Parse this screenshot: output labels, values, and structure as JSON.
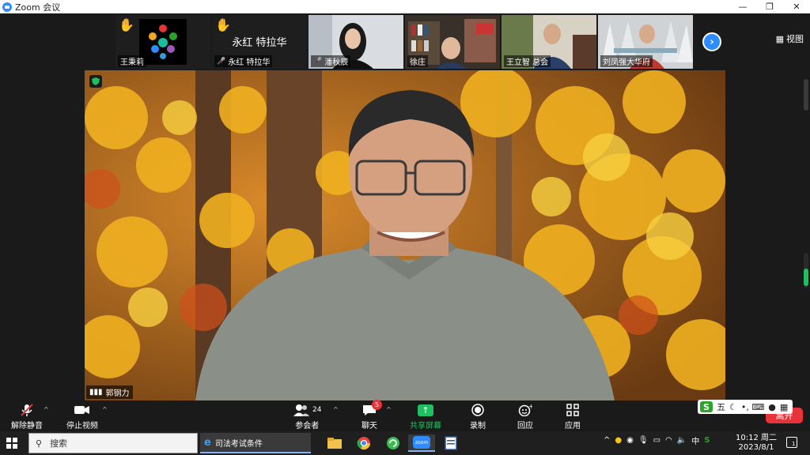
{
  "window": {
    "title": "Zoom 会议"
  },
  "view_button": {
    "label": "视图"
  },
  "participants_strip": [
    {
      "name": "王秉莉",
      "raised_hand": true,
      "muted": false
    },
    {
      "name": "永红 特拉华",
      "display_text": "永红 特拉华",
      "raised_hand": true,
      "muted": true
    },
    {
      "name": "潘秋辰",
      "raised_hand": false,
      "muted": true
    },
    {
      "name": "徐庄",
      "raised_hand": false,
      "muted": false
    },
    {
      "name": "王立智 总会",
      "raised_hand": false,
      "muted": false
    },
    {
      "name": "刘凤强大华府",
      "raised_hand": false,
      "muted": false
    }
  ],
  "main_speaker": {
    "name": "郭钢力"
  },
  "toolbar": {
    "unmute": "解除静音",
    "stop_video": "停止视频",
    "participants": "参会者",
    "participants_count": "24",
    "chat": "聊天",
    "chat_badge": "5",
    "share": "共享屏幕",
    "record": "录制",
    "reactions": "回应",
    "apps": "应用",
    "leave": "离开"
  },
  "ime": {
    "logo": "S",
    "mode": "五",
    "symbols": "•,  ⌨"
  },
  "taskbar": {
    "search_placeholder": "搜索",
    "browser_tab": "司法考试条件",
    "zoom_app": "zoom",
    "tray_ime": "中",
    "time": "10:12 周二",
    "date": "2023/8/1",
    "notification_count": "1"
  },
  "colors": {
    "accent": "#2d8cff",
    "danger": "#e8333a",
    "share_green": "#20c060"
  }
}
